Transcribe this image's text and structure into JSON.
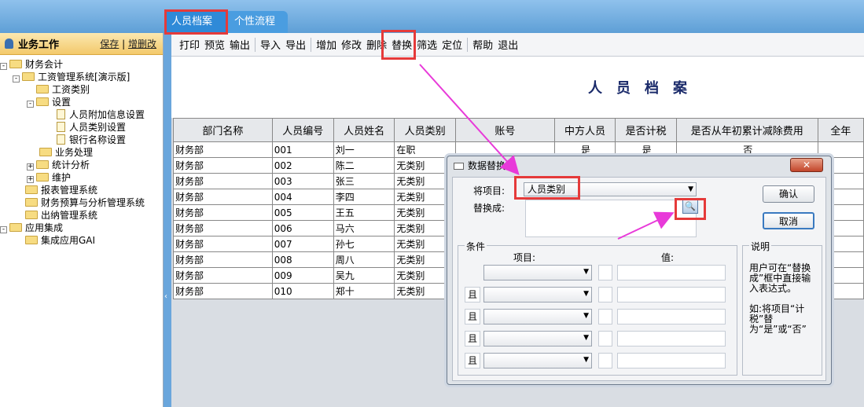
{
  "tabs": {
    "active": "人员档案",
    "active_close": "✕",
    "other": "个性流程"
  },
  "leftpanel": {
    "title": "业务工作",
    "link_save": "保存",
    "link_adddel": "增删改",
    "tree": [
      "财务会计",
      "工资管理系统[演示版]",
      "工资类别",
      "设置",
      "人员附加信息设置",
      "人员类别设置",
      "银行名称设置",
      "业务处理",
      "统计分析",
      "维护",
      "报表管理系统",
      "财务预算与分析管理系统",
      "出纳管理系统",
      "应用集成",
      "集成应用GAI"
    ]
  },
  "toolbar": {
    "print": "打印",
    "preview": "预览",
    "output": "输出",
    "import": "导入",
    "export": "导出",
    "add": "增加",
    "edit": "修改",
    "delete": "删除",
    "replace": "替换",
    "filter": "筛选",
    "locate": "定位",
    "help": "帮助",
    "exit": "退出"
  },
  "doc_title": "人员档案",
  "table": {
    "headers": [
      "部门名称",
      "人员编号",
      "人员姓名",
      "人员类别",
      "账号",
      "中方人员",
      "是否计税",
      "是否从年初累计减除费用",
      "全年"
    ],
    "rows": [
      [
        "财务部",
        "001",
        "刘一",
        "在职",
        "",
        "是",
        "是",
        "否"
      ],
      [
        "财务部",
        "002",
        "陈二",
        "无类别",
        "",
        "",
        "",
        ""
      ],
      [
        "财务部",
        "003",
        "张三",
        "无类别",
        "",
        "",
        "",
        ""
      ],
      [
        "财务部",
        "004",
        "李四",
        "无类别",
        "",
        "",
        "",
        ""
      ],
      [
        "财务部",
        "005",
        "王五",
        "无类别",
        "",
        "",
        "",
        ""
      ],
      [
        "财务部",
        "006",
        "马六",
        "无类别",
        "",
        "",
        "",
        ""
      ],
      [
        "财务部",
        "007",
        "孙七",
        "无类别",
        "",
        "",
        "",
        ""
      ],
      [
        "财务部",
        "008",
        "周八",
        "无类别",
        "",
        "",
        "",
        ""
      ],
      [
        "财务部",
        "009",
        "吴九",
        "无类别",
        "",
        "",
        "",
        ""
      ],
      [
        "财务部",
        "010",
        "郑十",
        "无类别",
        "",
        "",
        "",
        ""
      ]
    ]
  },
  "dialog": {
    "title": "数据替换",
    "close": "✕",
    "field_label": "将项目:",
    "field_value": "人员类别",
    "replace_label": "替换成:",
    "confirm": "确认",
    "cancel": "取消",
    "conditions_title": "条件",
    "col_item": "项目:",
    "col_value": "值:",
    "and_label": "且",
    "note_title": "说明",
    "note_text1": "用户可在“替换成”框中直接输入表达式。",
    "note_text2": "如:将项目“计税”替为“是”或“否”"
  },
  "colors": {
    "highlight": "#e53a3a",
    "arrow": "#e83ad9",
    "tab_active": "#2f8ad8"
  }
}
